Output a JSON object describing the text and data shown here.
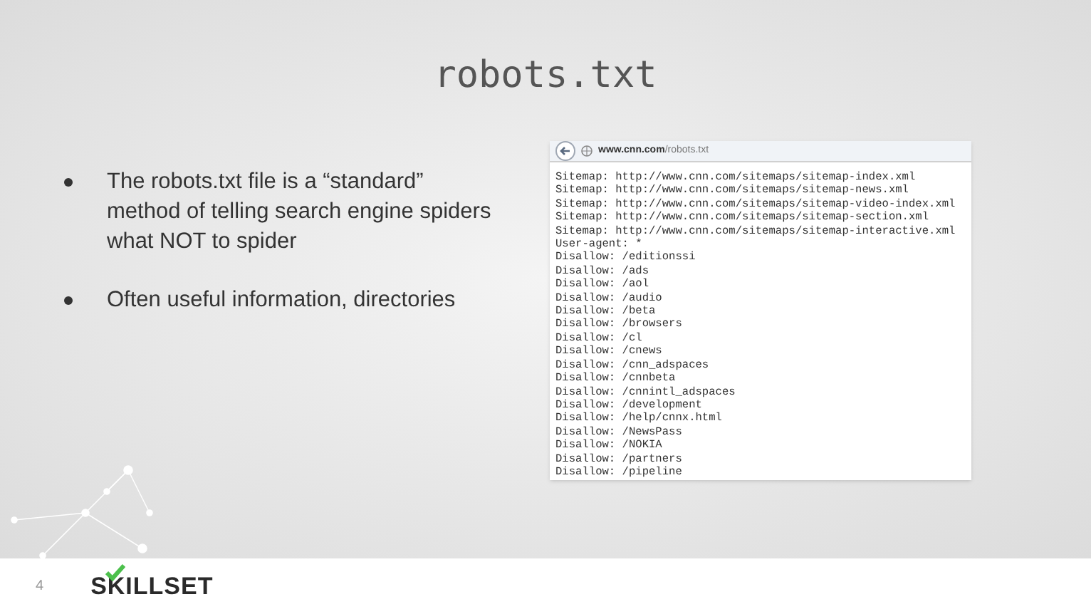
{
  "slide": {
    "title": "robots.txt",
    "bullets": [
      {
        "text": "The robots.txt file is a “standard” method of telling search engine spiders what NOT to spider"
      },
      {
        "text": "Often useful information, directories"
      }
    ],
    "browser": {
      "url_host": "www.cnn.com",
      "url_path": "/robots.txt",
      "lines": [
        "Sitemap: http://www.cnn.com/sitemaps/sitemap-index.xml",
        "Sitemap: http://www.cnn.com/sitemaps/sitemap-news.xml",
        "Sitemap: http://www.cnn.com/sitemaps/sitemap-video-index.xml",
        "Sitemap: http://www.cnn.com/sitemaps/sitemap-section.xml",
        "Sitemap: http://www.cnn.com/sitemaps/sitemap-interactive.xml",
        "User-agent: *",
        "Disallow: /editionssi",
        "Disallow: /ads",
        "Disallow: /aol",
        "Disallow: /audio",
        "Disallow: /beta",
        "Disallow: /browsers",
        "Disallow: /cl",
        "Disallow: /cnews",
        "Disallow: /cnn_adspaces",
        "Disallow: /cnnbeta",
        "Disallow: /cnnintl_adspaces",
        "Disallow: /development",
        "Disallow: /help/cnnx.html",
        "Disallow: /NewsPass",
        "Disallow: /NOKIA",
        "Disallow: /partners",
        "Disallow: /pipeline"
      ]
    }
  },
  "footer": {
    "page_number": "4",
    "logo": "SKILLSET"
  }
}
